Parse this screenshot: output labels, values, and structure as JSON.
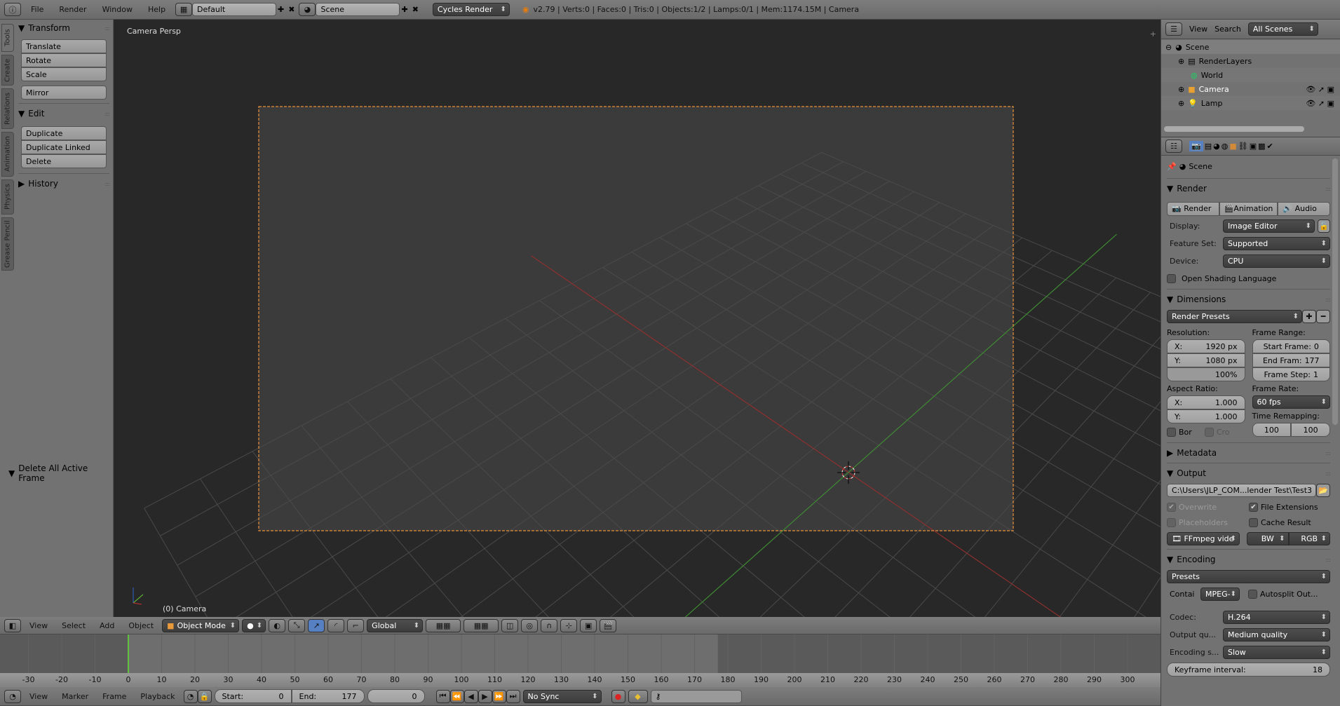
{
  "topbar": {
    "menus": [
      "File",
      "Render",
      "Window",
      "Help"
    ],
    "layout": "Default",
    "scene": "Scene",
    "engine": "Cycles Render",
    "stats": "v2.79 | Verts:0 | Faces:0 | Tris:0 | Objects:1/2 | Lamps:0/1 | Mem:1174.15M | Camera"
  },
  "toolshelf": {
    "tabs": [
      "Tools",
      "Create",
      "Relations",
      "Animation",
      "Physics",
      "Grease Pencil"
    ],
    "transform": {
      "title": "Transform",
      "items": [
        "Translate",
        "Rotate",
        "Scale"
      ],
      "mirror": "Mirror"
    },
    "edit": {
      "title": "Edit",
      "items": [
        "Duplicate",
        "Duplicate Linked",
        "Delete"
      ]
    },
    "history": "History",
    "operator": "Delete All Active Frame"
  },
  "viewport": {
    "view_name": "Camera Persp",
    "object_label": "(0) Camera",
    "colors": {
      "frame": "#e8913a",
      "x_axis": "#8e2f2f",
      "y_axis": "#3f8a33"
    }
  },
  "view3d_header": {
    "menus": [
      "View",
      "Select",
      "Add",
      "Object"
    ],
    "mode": "Object Mode",
    "orientation": "Global"
  },
  "timeline": {
    "ticks": [
      -30,
      -20,
      -10,
      0,
      10,
      20,
      30,
      40,
      50,
      60,
      70,
      80,
      90,
      100,
      110,
      120,
      130,
      140,
      150,
      160,
      170,
      180,
      190,
      200,
      210,
      220,
      230,
      240,
      250,
      260,
      270,
      280,
      290,
      300
    ],
    "current_frame": 0,
    "start": 0,
    "end": 177,
    "header": {
      "menus": [
        "View",
        "Marker",
        "Frame",
        "Playback"
      ],
      "start_label": "Start:",
      "start": "0",
      "end_label": "End:",
      "end": "177",
      "frame": "0",
      "sync": "No Sync"
    }
  },
  "outliner": {
    "view": "View",
    "search": "Search",
    "filter": "All Scenes",
    "items": [
      {
        "name": "Scene"
      },
      {
        "name": "RenderLayers"
      },
      {
        "name": "World"
      },
      {
        "name": "Camera"
      },
      {
        "name": "Lamp"
      }
    ]
  },
  "properties": {
    "context": "Scene",
    "render": {
      "title": "Render",
      "buttons": [
        "Render",
        "Animation",
        "Audio"
      ],
      "display_label": "Display:",
      "display": "Image Editor",
      "feature_label": "Feature Set:",
      "feature": "Supported",
      "device_label": "Device:",
      "device": "CPU",
      "osl": "Open Shading Language"
    },
    "dimensions": {
      "title": "Dimensions",
      "presets": "Render Presets",
      "resolution_label": "Resolution:",
      "res_x_label": "X:",
      "res_x": "1920 px",
      "res_y_label": "Y:",
      "res_y": "1080 px",
      "res_pct": "100%",
      "frame_range_label": "Frame Range:",
      "start_label": "Start Frame:",
      "start": "0",
      "end_label": "End Fram:",
      "end": "177",
      "step_label": "Frame Step:",
      "step": "1",
      "aspect_label": "Aspect Ratio:",
      "asp_x_label": "X:",
      "asp_x": "1.000",
      "asp_y_label": "Y:",
      "asp_y": "1.000",
      "frame_rate_label": "Frame Rate:",
      "frame_rate": "60 fps",
      "remap_label": "Time Remapping:",
      "remap_old": "100",
      "remap_new": "100",
      "border": "Bor",
      "crop": "Cro"
    },
    "metadata": "Metadata",
    "output": {
      "title": "Output",
      "path": "C:\\Users\\JLP_COM...lender Test\\Test3",
      "overwrite": "Overwrite",
      "file_ext": "File Extensions",
      "placeholders": "Placeholders",
      "cache": "Cache Result",
      "format": "FFmpeg vide",
      "bw": "BW",
      "rgb": "RGB"
    },
    "encoding": {
      "title": "Encoding",
      "presets": "Presets",
      "container_label": "Contai",
      "container": "MPEG-",
      "autosplit": "Autosplit Out...",
      "codec_label": "Codec:",
      "codec": "H.264",
      "quality_label": "Output qu...",
      "quality": "Medium quality",
      "speed_label": "Encoding s...",
      "speed": "Slow",
      "keyframe_label": "Keyframe interval:",
      "keyframe": "18"
    }
  }
}
